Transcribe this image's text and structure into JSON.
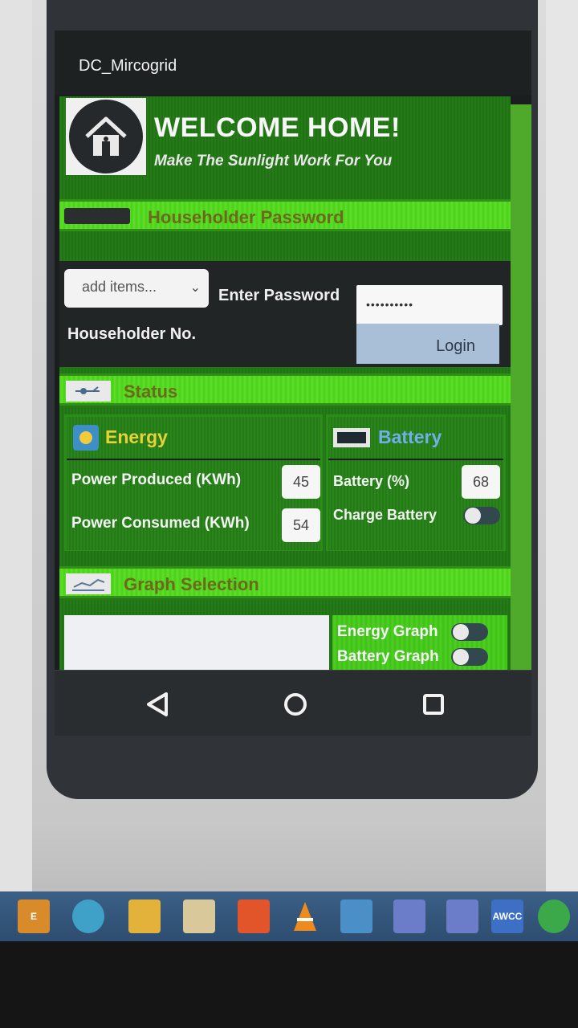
{
  "app": {
    "title": "DC_Mircogrid"
  },
  "header": {
    "welcome": "WELCOME HOME!",
    "tagline": "Make The Sunlight Work For You"
  },
  "password_section": {
    "bar_label": "Householder Password",
    "dropdown_selected": "add items...",
    "enter_password_label": "Enter Password",
    "password_value": "••••••••••",
    "householder_no_label": "Householder No.",
    "login_label": "Login"
  },
  "status_section": {
    "bar_label": "Status",
    "energy": {
      "heading": "Energy",
      "power_produced_label": "Power Produced (KWh)",
      "power_produced_value": "45",
      "power_consumed_label": "Power Consumed (KWh)",
      "power_consumed_value": "54"
    },
    "battery": {
      "heading": "Battery",
      "battery_label": "Battery (%)",
      "battery_value": "68",
      "charge_label": "Charge Battery",
      "charge_on": false
    }
  },
  "graph_section": {
    "bar_label": "Graph Selection",
    "energy_graph_label": "Energy Graph",
    "energy_graph_on": false,
    "battery_graph_label": "Battery Graph",
    "battery_graph_on": false
  },
  "navbar": {
    "back_icon": "back-triangle-icon",
    "home_icon": "home-circle-icon",
    "recents_icon": "recents-square-icon"
  },
  "taskbar": {
    "icons": [
      "edge-icon",
      "chrome-icon",
      "file-explorer-icon",
      "store-icon",
      "office-icon",
      "vlc-icon",
      "mail-icon",
      "app-icon",
      "app-icon",
      "alienware-icon",
      "spotify-icon"
    ],
    "alienware_text": "AWCC"
  },
  "colors": {
    "accent_green": "#4ccf1c",
    "dark_green": "#227515",
    "login_bg": "#a9bfd8",
    "battery_heading": "#6fb0e8",
    "energy_heading": "#e8d23a"
  }
}
